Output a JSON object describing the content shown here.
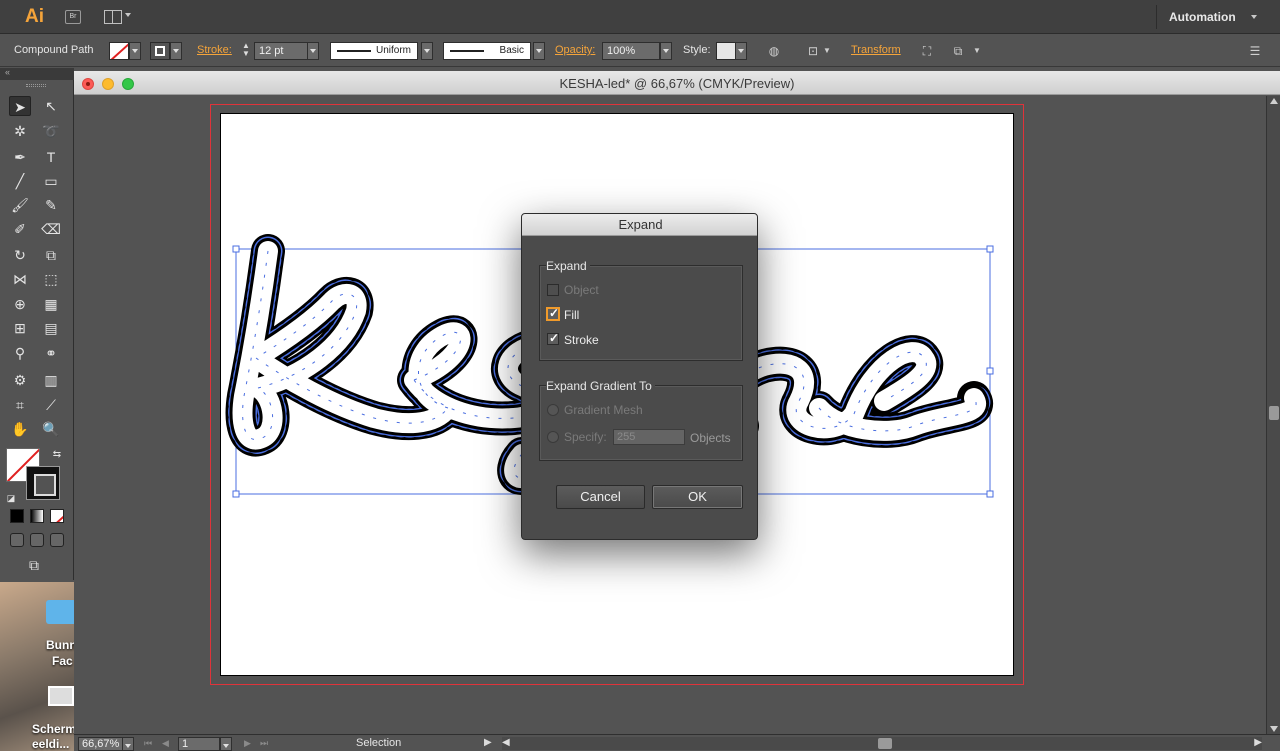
{
  "app": {
    "logo": "Ai",
    "bridge": "Br",
    "workspace": "Automation"
  },
  "control_bar": {
    "selection_type": "Compound Path",
    "stroke_label": "Stroke:",
    "stroke_weight": "12 pt",
    "profile": "Uniform",
    "brush": "Basic",
    "opacity_label": "Opacity:",
    "opacity_value": "100%",
    "style_label": "Style:",
    "transform_label": "Transform"
  },
  "document": {
    "title": "KESHA-led* @ 66,67% (CMYK/Preview)",
    "artwork_text": "Kesha",
    "artwork_fill_color": "#ffffff",
    "artwork_stroke_color": "#000000",
    "selection_color": "#4a6ee0"
  },
  "status_bar": {
    "zoom": "66,67%",
    "artboard_number": "1",
    "tool": "Selection"
  },
  "desktop": {
    "items": [
      "Bunn",
      "Fac",
      "Scherm",
      "eeldi..."
    ]
  },
  "dialog": {
    "title": "Expand",
    "expand_group": {
      "label": "Expand",
      "object": {
        "label": "Object",
        "checked": false,
        "enabled": false
      },
      "fill": {
        "label": "Fill",
        "checked": true,
        "enabled": true
      },
      "stroke": {
        "label": "Stroke",
        "checked": true,
        "enabled": true
      }
    },
    "gradient_group": {
      "label": "Expand Gradient To",
      "gradient_mesh": {
        "label": "Gradient Mesh"
      },
      "specify": {
        "label": "Specify:",
        "value": "255",
        "suffix": "Objects"
      }
    },
    "cancel_label": "Cancel",
    "ok_label": "OK"
  }
}
